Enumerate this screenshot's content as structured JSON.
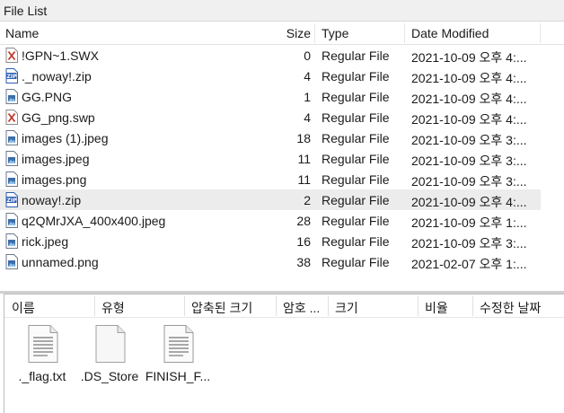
{
  "window": {
    "title": "File List"
  },
  "list": {
    "columns": {
      "name": "Name",
      "size": "Size",
      "type": "Type",
      "date": "Date Modified"
    },
    "rows": [
      {
        "name": "!GPN~1.SWX",
        "size": "0",
        "type": "Regular File",
        "date": "2021-10-09 오후 4:...",
        "icon": "x-file-icon"
      },
      {
        "name": "._noway!.zip",
        "size": "4",
        "type": "Regular File",
        "date": "2021-10-09 오후 4:...",
        "icon": "zip-file-icon"
      },
      {
        "name": "GG.PNG",
        "size": "1",
        "type": "Regular File",
        "date": "2021-10-09 오후 4:...",
        "icon": "image-file-icon"
      },
      {
        "name": "GG_png.swp",
        "size": "4",
        "type": "Regular File",
        "date": "2021-10-09 오후 4:...",
        "icon": "x-file-icon"
      },
      {
        "name": "images (1).jpeg",
        "size": "18",
        "type": "Regular File",
        "date": "2021-10-09 오후 3:...",
        "icon": "image-file-icon"
      },
      {
        "name": "images.jpeg",
        "size": "11",
        "type": "Regular File",
        "date": "2021-10-09 오후 3:...",
        "icon": "image-file-icon"
      },
      {
        "name": "images.png",
        "size": "11",
        "type": "Regular File",
        "date": "2021-10-09 오후 3:...",
        "icon": "image-file-icon"
      },
      {
        "name": "noway!.zip",
        "size": "2",
        "type": "Regular File",
        "date": "2021-10-09 오후 4:...",
        "icon": "zip-file-icon"
      },
      {
        "name": "q2QMrJXA_400x400.jpeg",
        "size": "28",
        "type": "Regular File",
        "date": "2021-10-09 오후 1:...",
        "icon": "image-file-icon"
      },
      {
        "name": "rick.jpeg",
        "size": "16",
        "type": "Regular File",
        "date": "2021-10-09 오후 3:...",
        "icon": "image-file-icon"
      },
      {
        "name": "unnamed.png",
        "size": "38",
        "type": "Regular File",
        "date": "2021-02-07 오후 1:...",
        "icon": "image-file-icon"
      }
    ],
    "selected_row": "noway!.zip"
  },
  "archive": {
    "columns": {
      "name": "이름",
      "type": "유형",
      "compressed_size": "압축된 크기",
      "password": "암호 ...",
      "size": "크기",
      "ratio": "비율",
      "modified": "수정한 날짜"
    },
    "files": [
      {
        "label": "._flag.txt",
        "icon": "text-document-icon"
      },
      {
        "label": ".DS_Store",
        "icon": "blank-document-icon"
      },
      {
        "label": "FINISH_F...",
        "icon": "text-document-icon"
      }
    ]
  },
  "colors": {
    "selected_row": "#ececec",
    "title_bar": "#f0f0f0",
    "zip_icon": "#2f5fb3",
    "x_icon": "#c0392b"
  }
}
